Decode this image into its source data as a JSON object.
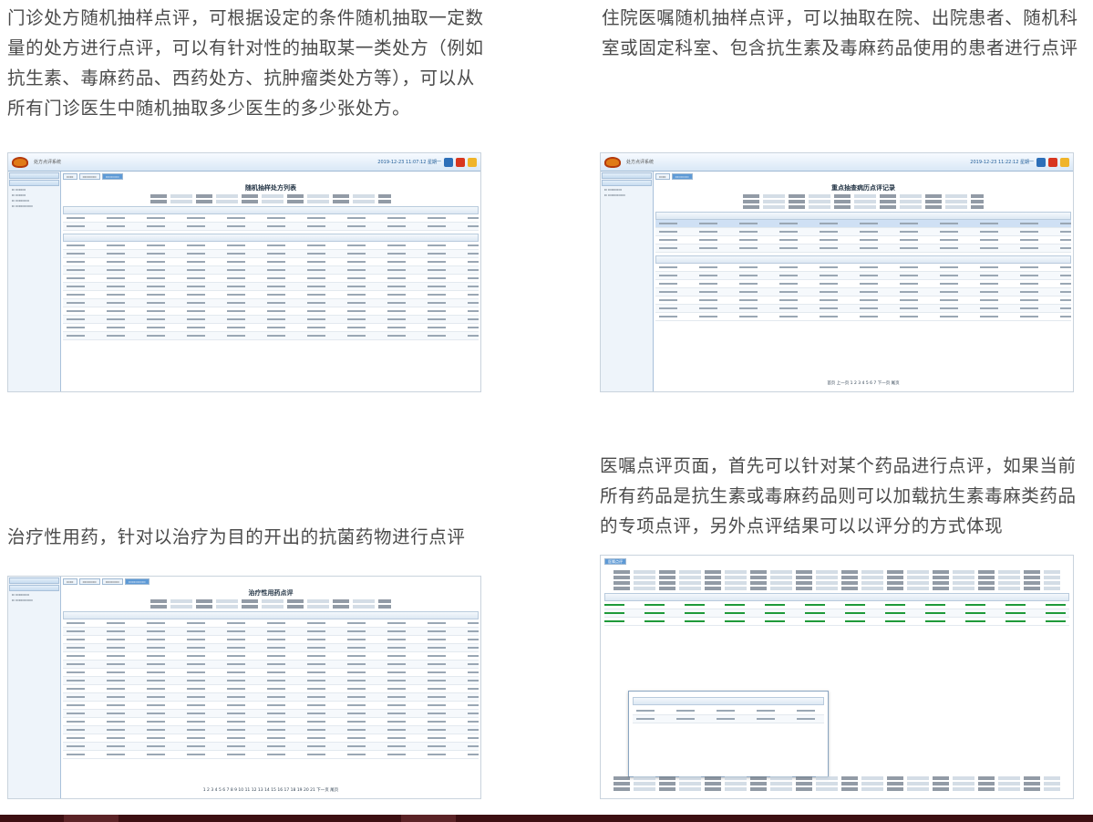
{
  "paragraphs": {
    "outpatient": "门诊处方随机抽样点评，可根据设定的条件随机抽取一定数量的处方进行点评，可以有针对性的抽取某一类处方（例如抗生素、毒麻药品、西药处方、抗肿瘤类处方等），可以从所有门诊医生中随机抽取多少医生的多少张处方。",
    "inpatient": "住院医嘱随机抽样点评，可以抽取在院、出院患者、随机科室或固定科室、包含抗生素及毒麻药品使用的患者进行点评",
    "therapeutic": "治疗性用药，针对以治疗为目的开出的抗菌药物进行点评",
    "order_review": "医嘱点评页面，首先可以针对某个药品进行点评，如果当前所有药品是抗生素或毒麻药品则可以加载抗生素毒麻类药品的专项点评，另外点评结果可以以评分的方式体现"
  },
  "screens": {
    "prescription_list": {
      "title": "随机抽样处方列表",
      "app": "处方点评系统",
      "clock": "2019-12-23 11:07:12 星期一"
    },
    "inpatient_records": {
      "title": "重点抽查病历点评记录",
      "app": "处方点评系统",
      "clock": "2019-12-23 11:22:12 星期一",
      "pager": "首页 上一页 1 2 3 4 5 6 7 下一页 尾页"
    },
    "therapeutic_drugs": {
      "title": "治疗性用药点评",
      "pager": "1 2 3 4 5 6 7 8 9 10 11 12 13 14 15 16 17 18 19 20 21 下一页 尾页"
    },
    "order_review_page": {
      "title": "医嘱点评"
    }
  },
  "colors": {
    "brand": "#b4220c",
    "accent": "#5e9ad6",
    "footer": "#3d0f12"
  }
}
